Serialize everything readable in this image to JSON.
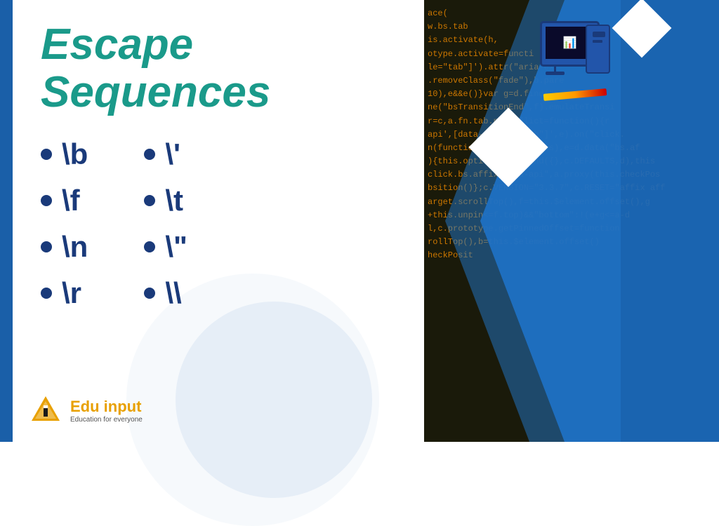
{
  "page": {
    "title": "Escape Sequences",
    "background_color": "#ffffff"
  },
  "left_column": {
    "items": [
      {
        "label": "\\b"
      },
      {
        "label": "\\f"
      },
      {
        "label": "\\n"
      },
      {
        "label": "\\r"
      }
    ]
  },
  "right_column": {
    "items": [
      {
        "label": "\\'"
      },
      {
        "label": "\\t"
      },
      {
        "label": "\\\""
      },
      {
        "label": "\\\\"
      }
    ]
  },
  "logo": {
    "name_part1": "Edu ",
    "name_part2": "input",
    "tagline": "Education for everyone"
  },
  "code_lines": [
    "ace(",
    "w.bs.tab",
    "is.activate(h,",
    "otype.activate=functi",
    "le=\"tab\"]').attr(\"aria-ex",
    ".removeClass(\"fade\"),b.pare",
    "10),e&&e()}var g=d.find(\"> .act",
    "ne(\"bsTransitionEnd\",f).emulateTransi",
    "r=c,a.fn.tab.noConflict=function(){r",
    "api',[data-toggle=\"tab\"]',e).on(\"click.",
    "n(function(){var d=a(this),e=d.data(\"bs.af",
    "){this.options=a.extend({},c.DEFAULTS,d),this",
    "click.bs.affix.data-api\",a.proxy(this.checkPos",
    "bsition()};c.VERSION=\"3.3.7\",c.RESET=\"affix aff",
    "arget.scrollTop(),f=this.$element.offset(),g",
    "+this.unpin<=f.top)&&\"bottom\":!(e+g<=a-d",
    "l,c.prototype.getPinnedOffset=function",
    "rollTop(),b=this.$element.offset()",
    "heckPosit"
  ]
}
